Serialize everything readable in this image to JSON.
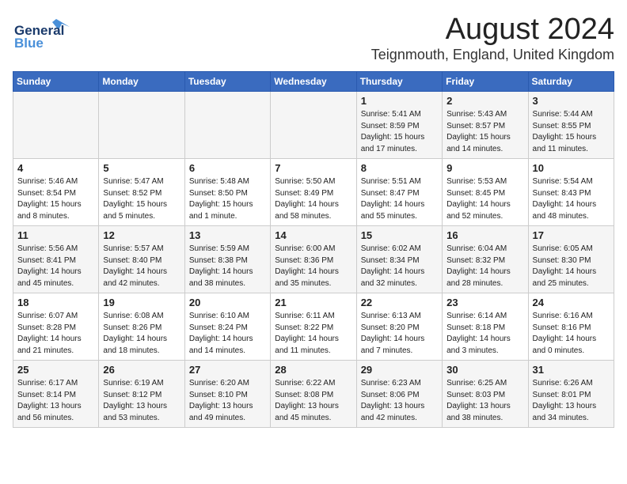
{
  "header": {
    "logo_general": "General",
    "logo_blue": "Blue",
    "main_title": "August 2024",
    "subtitle": "Teignmouth, England, United Kingdom"
  },
  "weekdays": [
    "Sunday",
    "Monday",
    "Tuesday",
    "Wednesday",
    "Thursday",
    "Friday",
    "Saturday"
  ],
  "weeks": [
    [
      {
        "day": "",
        "sunrise": "",
        "sunset": "",
        "daylight": ""
      },
      {
        "day": "",
        "sunrise": "",
        "sunset": "",
        "daylight": ""
      },
      {
        "day": "",
        "sunrise": "",
        "sunset": "",
        "daylight": ""
      },
      {
        "day": "",
        "sunrise": "",
        "sunset": "",
        "daylight": ""
      },
      {
        "day": "1",
        "sunrise": "Sunrise: 5:41 AM",
        "sunset": "Sunset: 8:59 PM",
        "daylight": "Daylight: 15 hours and 17 minutes."
      },
      {
        "day": "2",
        "sunrise": "Sunrise: 5:43 AM",
        "sunset": "Sunset: 8:57 PM",
        "daylight": "Daylight: 15 hours and 14 minutes."
      },
      {
        "day": "3",
        "sunrise": "Sunrise: 5:44 AM",
        "sunset": "Sunset: 8:55 PM",
        "daylight": "Daylight: 15 hours and 11 minutes."
      }
    ],
    [
      {
        "day": "4",
        "sunrise": "Sunrise: 5:46 AM",
        "sunset": "Sunset: 8:54 PM",
        "daylight": "Daylight: 15 hours and 8 minutes."
      },
      {
        "day": "5",
        "sunrise": "Sunrise: 5:47 AM",
        "sunset": "Sunset: 8:52 PM",
        "daylight": "Daylight: 15 hours and 5 minutes."
      },
      {
        "day": "6",
        "sunrise": "Sunrise: 5:48 AM",
        "sunset": "Sunset: 8:50 PM",
        "daylight": "Daylight: 15 hours and 1 minute."
      },
      {
        "day": "7",
        "sunrise": "Sunrise: 5:50 AM",
        "sunset": "Sunset: 8:49 PM",
        "daylight": "Daylight: 14 hours and 58 minutes."
      },
      {
        "day": "8",
        "sunrise": "Sunrise: 5:51 AM",
        "sunset": "Sunset: 8:47 PM",
        "daylight": "Daylight: 14 hours and 55 minutes."
      },
      {
        "day": "9",
        "sunrise": "Sunrise: 5:53 AM",
        "sunset": "Sunset: 8:45 PM",
        "daylight": "Daylight: 14 hours and 52 minutes."
      },
      {
        "day": "10",
        "sunrise": "Sunrise: 5:54 AM",
        "sunset": "Sunset: 8:43 PM",
        "daylight": "Daylight: 14 hours and 48 minutes."
      }
    ],
    [
      {
        "day": "11",
        "sunrise": "Sunrise: 5:56 AM",
        "sunset": "Sunset: 8:41 PM",
        "daylight": "Daylight: 14 hours and 45 minutes."
      },
      {
        "day": "12",
        "sunrise": "Sunrise: 5:57 AM",
        "sunset": "Sunset: 8:40 PM",
        "daylight": "Daylight: 14 hours and 42 minutes."
      },
      {
        "day": "13",
        "sunrise": "Sunrise: 5:59 AM",
        "sunset": "Sunset: 8:38 PM",
        "daylight": "Daylight: 14 hours and 38 minutes."
      },
      {
        "day": "14",
        "sunrise": "Sunrise: 6:00 AM",
        "sunset": "Sunset: 8:36 PM",
        "daylight": "Daylight: 14 hours and 35 minutes."
      },
      {
        "day": "15",
        "sunrise": "Sunrise: 6:02 AM",
        "sunset": "Sunset: 8:34 PM",
        "daylight": "Daylight: 14 hours and 32 minutes."
      },
      {
        "day": "16",
        "sunrise": "Sunrise: 6:04 AM",
        "sunset": "Sunset: 8:32 PM",
        "daylight": "Daylight: 14 hours and 28 minutes."
      },
      {
        "day": "17",
        "sunrise": "Sunrise: 6:05 AM",
        "sunset": "Sunset: 8:30 PM",
        "daylight": "Daylight: 14 hours and 25 minutes."
      }
    ],
    [
      {
        "day": "18",
        "sunrise": "Sunrise: 6:07 AM",
        "sunset": "Sunset: 8:28 PM",
        "daylight": "Daylight: 14 hours and 21 minutes."
      },
      {
        "day": "19",
        "sunrise": "Sunrise: 6:08 AM",
        "sunset": "Sunset: 8:26 PM",
        "daylight": "Daylight: 14 hours and 18 minutes."
      },
      {
        "day": "20",
        "sunrise": "Sunrise: 6:10 AM",
        "sunset": "Sunset: 8:24 PM",
        "daylight": "Daylight: 14 hours and 14 minutes."
      },
      {
        "day": "21",
        "sunrise": "Sunrise: 6:11 AM",
        "sunset": "Sunset: 8:22 PM",
        "daylight": "Daylight: 14 hours and 11 minutes."
      },
      {
        "day": "22",
        "sunrise": "Sunrise: 6:13 AM",
        "sunset": "Sunset: 8:20 PM",
        "daylight": "Daylight: 14 hours and 7 minutes."
      },
      {
        "day": "23",
        "sunrise": "Sunrise: 6:14 AM",
        "sunset": "Sunset: 8:18 PM",
        "daylight": "Daylight: 14 hours and 3 minutes."
      },
      {
        "day": "24",
        "sunrise": "Sunrise: 6:16 AM",
        "sunset": "Sunset: 8:16 PM",
        "daylight": "Daylight: 14 hours and 0 minutes."
      }
    ],
    [
      {
        "day": "25",
        "sunrise": "Sunrise: 6:17 AM",
        "sunset": "Sunset: 8:14 PM",
        "daylight": "Daylight: 13 hours and 56 minutes."
      },
      {
        "day": "26",
        "sunrise": "Sunrise: 6:19 AM",
        "sunset": "Sunset: 8:12 PM",
        "daylight": "Daylight: 13 hours and 53 minutes."
      },
      {
        "day": "27",
        "sunrise": "Sunrise: 6:20 AM",
        "sunset": "Sunset: 8:10 PM",
        "daylight": "Daylight: 13 hours and 49 minutes."
      },
      {
        "day": "28",
        "sunrise": "Sunrise: 6:22 AM",
        "sunset": "Sunset: 8:08 PM",
        "daylight": "Daylight: 13 hours and 45 minutes."
      },
      {
        "day": "29",
        "sunrise": "Sunrise: 6:23 AM",
        "sunset": "Sunset: 8:06 PM",
        "daylight": "Daylight: 13 hours and 42 minutes."
      },
      {
        "day": "30",
        "sunrise": "Sunrise: 6:25 AM",
        "sunset": "Sunset: 8:03 PM",
        "daylight": "Daylight: 13 hours and 38 minutes."
      },
      {
        "day": "31",
        "sunrise": "Sunrise: 6:26 AM",
        "sunset": "Sunset: 8:01 PM",
        "daylight": "Daylight: 13 hours and 34 minutes."
      }
    ]
  ]
}
